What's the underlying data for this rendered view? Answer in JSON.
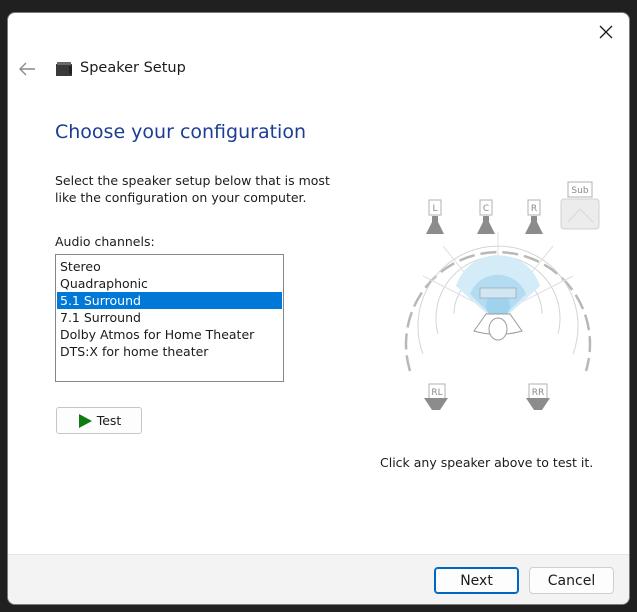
{
  "window": {
    "title": "Speaker Setup"
  },
  "page": {
    "heading": "Choose your configuration",
    "instruction": "Select the speaker setup below that is most like the configuration on your computer.",
    "channels_label": "Audio channels:",
    "test_button": "Test",
    "hint": "Click any speaker above to test it."
  },
  "channels": [
    {
      "label": "Stereo",
      "selected": false
    },
    {
      "label": "Quadraphonic",
      "selected": false
    },
    {
      "label": "5.1 Surround",
      "selected": true
    },
    {
      "label": "7.1 Surround",
      "selected": false
    },
    {
      "label": "Dolby Atmos for Home Theater",
      "selected": false
    },
    {
      "label": "DTS:X for home theater",
      "selected": false
    }
  ],
  "speakers": {
    "left": "L",
    "center": "C",
    "right": "R",
    "sub": "Sub",
    "rear_left": "RL",
    "rear_right": "RR"
  },
  "footer": {
    "next": "Next",
    "cancel": "Cancel"
  },
  "colors": {
    "accent": "#0078d7",
    "heading": "#1c3d94",
    "play_icon": "#107c10"
  },
  "icons": {
    "close": "close-icon",
    "back": "back-arrow-icon",
    "app": "speaker-icon",
    "play": "play-icon"
  }
}
